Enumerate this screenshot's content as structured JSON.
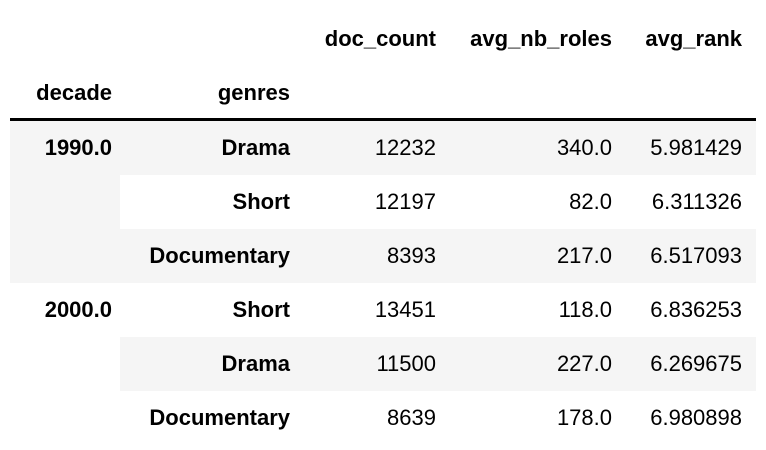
{
  "columns": {
    "doc_count": "doc_count",
    "avg_nb_roles": "avg_nb_roles",
    "avg_rank": "avg_rank"
  },
  "index_names": {
    "level0": "decade",
    "level1": "genres"
  },
  "groups": [
    {
      "decade": "1990.0",
      "rows": [
        {
          "genre": "Drama",
          "doc_count": "12232",
          "avg_nb_roles": "340.0",
          "avg_rank": "5.981429"
        },
        {
          "genre": "Short",
          "doc_count": "12197",
          "avg_nb_roles": "82.0",
          "avg_rank": "6.311326"
        },
        {
          "genre": "Documentary",
          "doc_count": "8393",
          "avg_nb_roles": "217.0",
          "avg_rank": "6.517093"
        }
      ]
    },
    {
      "decade": "2000.0",
      "rows": [
        {
          "genre": "Short",
          "doc_count": "13451",
          "avg_nb_roles": "118.0",
          "avg_rank": "6.836253"
        },
        {
          "genre": "Drama",
          "doc_count": "11500",
          "avg_nb_roles": "227.0",
          "avg_rank": "6.269675"
        },
        {
          "genre": "Documentary",
          "doc_count": "8639",
          "avg_nb_roles": "178.0",
          "avg_rank": "6.980898"
        }
      ]
    }
  ],
  "colors": {
    "text": "#000000",
    "row_stripe": "#f5f5f5",
    "background": "#ffffff"
  }
}
